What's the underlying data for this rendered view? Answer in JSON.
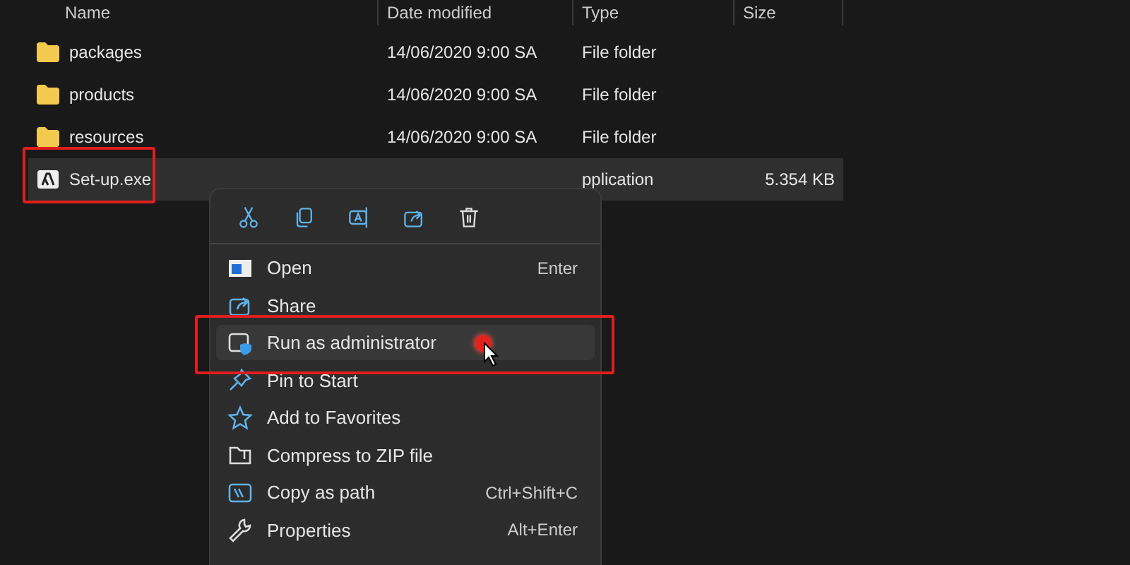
{
  "columns": [
    "Name",
    "Date modified",
    "Type",
    "Size"
  ],
  "files": [
    {
      "kind": "folder",
      "name": "packages",
      "date": "14/06/2020 9:00 SA",
      "type": "File folder",
      "selected": false
    },
    {
      "kind": "folder",
      "name": "products",
      "date": "14/06/2020 9:00 SA",
      "type": "File folder",
      "selected": false
    },
    {
      "kind": "folder",
      "name": "resources",
      "date": "14/06/2020 9:00 SA",
      "type": "File folder",
      "selected": false
    },
    {
      "kind": "app",
      "name": "Set-up.exe",
      "type": "pplication",
      "size": "5.354 KB",
      "selected": true
    }
  ],
  "menu": {
    "toolbar": [
      {
        "kind": "cut"
      },
      {
        "kind": "copy"
      },
      {
        "kind": "rename"
      },
      {
        "kind": "share"
      },
      {
        "kind": "delete"
      }
    ],
    "items": [
      {
        "kind": "open",
        "label": "Open",
        "shortcut": "Enter",
        "selected": false
      },
      {
        "kind": "share",
        "label": "Share",
        "selected": false
      },
      {
        "kind": "admin",
        "label": "Run as administrator",
        "selected": true
      },
      {
        "kind": "pin",
        "label": "Pin to Start",
        "selected": false
      },
      {
        "kind": "star",
        "label": "Add to Favorites",
        "selected": false
      },
      {
        "kind": "zip",
        "label": "Compress to ZIP file",
        "selected": false
      },
      {
        "kind": "path",
        "label": "Copy as path",
        "shortcut": "Ctrl+Shift+C",
        "selected": false
      },
      {
        "kind": "wrench",
        "label": "Properties",
        "shortcut": "Alt+Enter",
        "selected": false
      }
    ]
  }
}
